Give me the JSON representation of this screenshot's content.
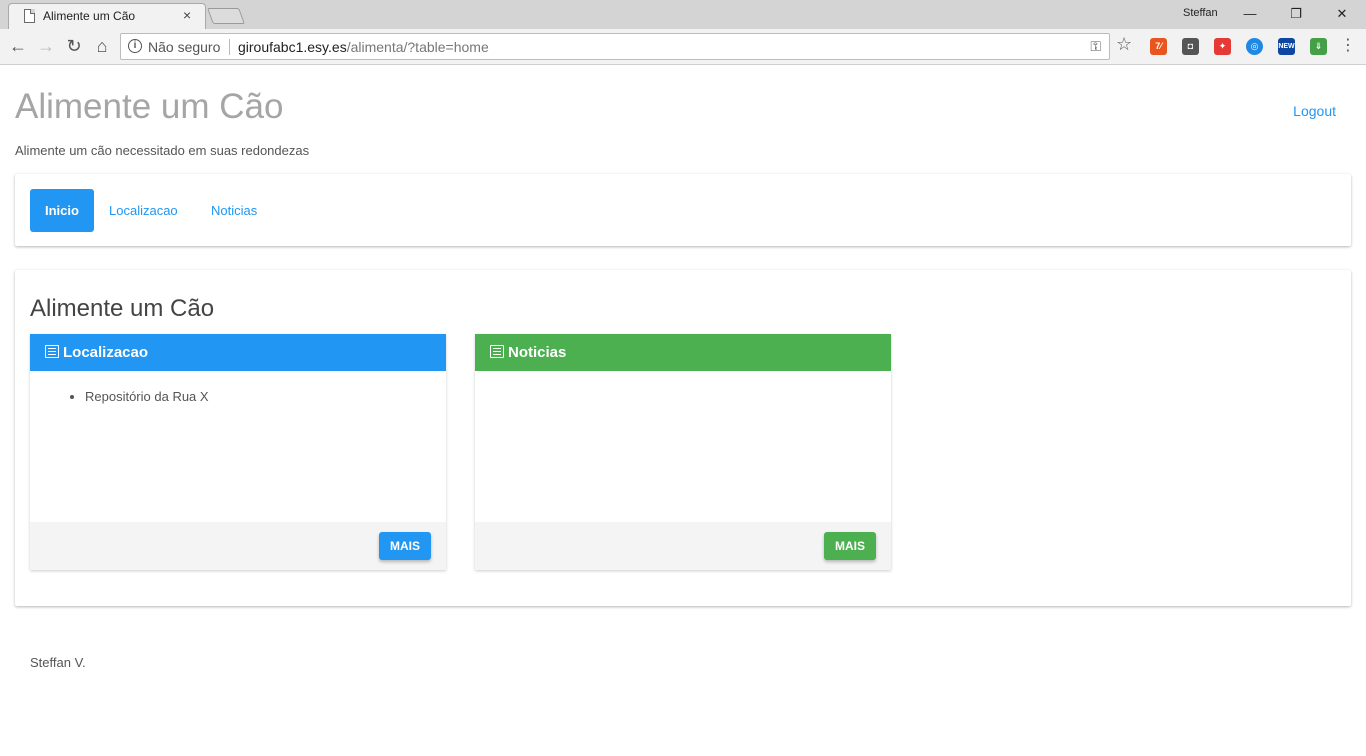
{
  "browser": {
    "tab_title": "Alimente um Cão",
    "tab_close": "×",
    "profile_name": "Steffan",
    "win_minimize": "—",
    "win_restore": "❐",
    "win_close": "✕",
    "nav_back": "←",
    "nav_forward": "→",
    "nav_reload": "↻",
    "nav_home": "⌂",
    "security_label": "Não seguro",
    "url_host": "giroufabc1.esy.es",
    "url_path": "/alimenta/?table=home",
    "key_icon": "⚿",
    "star_icon": "☆",
    "menu_icon": "⋮",
    "extensions": [
      {
        "name": "extension-icon-orange",
        "glyph": "7⁄",
        "color": "#e8551f"
      },
      {
        "name": "extension-icon-dark",
        "glyph": "◘",
        "color": "#555555"
      },
      {
        "name": "extension-icon-colorwheel",
        "glyph": "✦",
        "color": "#e53935"
      },
      {
        "name": "extension-icon-blue-circle",
        "glyph": "◎",
        "color": "#1e88e5"
      },
      {
        "name": "extension-icon-news",
        "glyph": "NEW",
        "color": "#0d47a1"
      },
      {
        "name": "extension-icon-green-arrow",
        "glyph": "⇓",
        "color": "#43a047"
      }
    ]
  },
  "header": {
    "title": "Alimente um Cão",
    "subtitle": "Alimente um cão necessitado em suas redondezas",
    "logout": "Logout"
  },
  "nav": {
    "items": [
      {
        "label": "Inicio",
        "active": true
      },
      {
        "label": "Localizacao",
        "active": false
      },
      {
        "label": "Noticias",
        "active": false
      }
    ]
  },
  "main": {
    "heading": "Alimente um Cão",
    "panels": [
      {
        "title": "Localizacao",
        "color": "#2196f3",
        "items": [
          "Repositório da Rua X"
        ],
        "button": "MAIS"
      },
      {
        "title": "Noticias",
        "color": "#4caf50",
        "items": [],
        "button": "MAIS"
      }
    ]
  },
  "footer": {
    "text": "Steffan V."
  }
}
